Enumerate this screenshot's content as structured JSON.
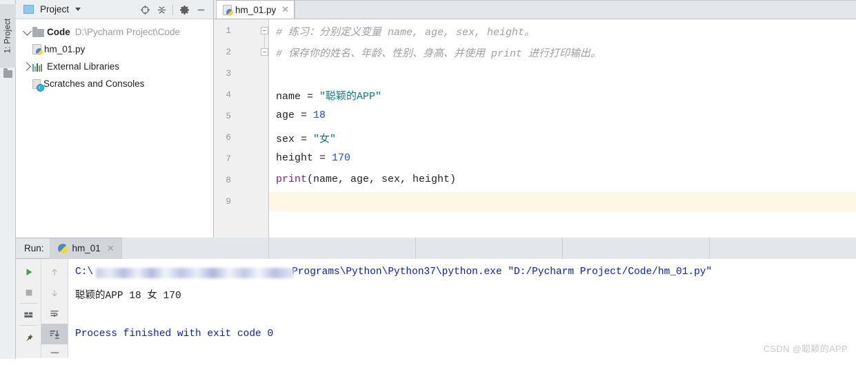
{
  "toolstrip": {
    "project_tab_label": "1: Project",
    "folder_icon": "folder-icon"
  },
  "project_panel": {
    "title": "Project",
    "caret_icon": "chevron-down-icon",
    "tools": [
      {
        "name": "locate-icon",
        "label": "Select Opened File"
      },
      {
        "name": "collapse-all-icon",
        "label": "Collapse All"
      },
      {
        "name": "gear-icon",
        "label": "Settings"
      },
      {
        "name": "minimize-icon",
        "label": "Hide"
      }
    ],
    "tree": [
      {
        "label": "Code",
        "path": "D:\\Pycharm Project\\Code",
        "icon": "folder-icon",
        "expander": "chevron-down-icon",
        "depth": 0,
        "bold": true
      },
      {
        "label": "hm_01.py",
        "path": "",
        "icon": "python-file-icon",
        "expander": "",
        "depth": 1,
        "bold": false
      },
      {
        "label": "External Libraries",
        "path": "",
        "icon": "libraries-icon",
        "expander": "chevron-right-icon",
        "depth": 0,
        "bold": false
      },
      {
        "label": "Scratches and Consoles",
        "path": "",
        "icon": "scratches-icon",
        "expander": "",
        "depth": 0,
        "bold": false
      }
    ]
  },
  "editor": {
    "tab": {
      "label": "hm_01.py",
      "icon": "python-file-icon",
      "close_icon": "close-icon"
    },
    "caret_line": 9,
    "lines": [
      {
        "n": 1,
        "fold": true,
        "segments": [
          {
            "t": "# 练习：分别定义变量 name, age, sex, height。",
            "c": "cmt"
          }
        ]
      },
      {
        "n": 2,
        "fold": true,
        "segments": [
          {
            "t": "# 保存你的姓名、年龄、性别、身高、并使用 print 进行打印输出。",
            "c": "cmt"
          }
        ]
      },
      {
        "n": 3,
        "fold": false,
        "segments": []
      },
      {
        "n": 4,
        "fold": false,
        "segments": [
          {
            "t": "name = ",
            "c": ""
          },
          {
            "t": "\"聪颖的APP\"",
            "c": "str"
          }
        ]
      },
      {
        "n": 5,
        "fold": false,
        "segments": [
          {
            "t": "age = ",
            "c": ""
          },
          {
            "t": "18",
            "c": "num"
          }
        ]
      },
      {
        "n": 6,
        "fold": false,
        "segments": [
          {
            "t": "sex = ",
            "c": ""
          },
          {
            "t": "\"女\"",
            "c": "str"
          }
        ]
      },
      {
        "n": 7,
        "fold": false,
        "segments": [
          {
            "t": "height = ",
            "c": ""
          },
          {
            "t": "170",
            "c": "num"
          }
        ]
      },
      {
        "n": 8,
        "fold": false,
        "segments": [
          {
            "t": "print",
            "c": "kw"
          },
          {
            "t": "(name, age, sex, height)",
            "c": ""
          }
        ]
      },
      {
        "n": 9,
        "fold": false,
        "segments": []
      }
    ]
  },
  "run_panel": {
    "run_label": "Run:",
    "tab": {
      "label": "hm_01",
      "icon": "python-icon",
      "close_icon": "close-icon"
    },
    "tools_left": [
      {
        "name": "run-icon",
        "label": "Rerun"
      },
      {
        "name": "stop-icon",
        "label": "Stop"
      },
      {
        "name": "layout-icon",
        "label": "Restore Layout"
      },
      {
        "name": "pin-icon",
        "label": "Pin Tab"
      }
    ],
    "tools_right": [
      {
        "name": "arrow-up-icon",
        "label": "Up the Stack Trace"
      },
      {
        "name": "arrow-down-icon",
        "label": "Down the Stack Trace"
      },
      {
        "name": "soft-wrap-icon",
        "label": "Use Soft Wraps"
      },
      {
        "name": "scroll-to-end-icon",
        "label": "Scroll to End"
      },
      {
        "name": "print-icon",
        "label": "Print"
      }
    ],
    "console": [
      {
        "text_prefix": "C:\\",
        "blurred": true,
        "text_suffix": "Programs\\Python\\Python37\\python.exe \"D:/Pycharm Project/Code/hm_01.py\"",
        "color": "cmdblue"
      },
      {
        "text_prefix": "聪颖的APP 18 女 170",
        "blurred": false,
        "text_suffix": "",
        "color": ""
      },
      {
        "text_prefix": "",
        "blurred": false,
        "text_suffix": "",
        "color": ""
      },
      {
        "text_prefix": "Process finished with exit code 0",
        "blurred": false,
        "text_suffix": "",
        "color": "cmdblue"
      }
    ]
  },
  "watermark": "CSDN @聪颖的APP",
  "colors": {
    "string": "#0c7a7a",
    "number": "#1a51c4",
    "keyword": "#7d1e7d",
    "comment": "#9aa0a6",
    "console_cmd": "#0a1fb0",
    "caret_line_bg": "#fdf8e6"
  }
}
